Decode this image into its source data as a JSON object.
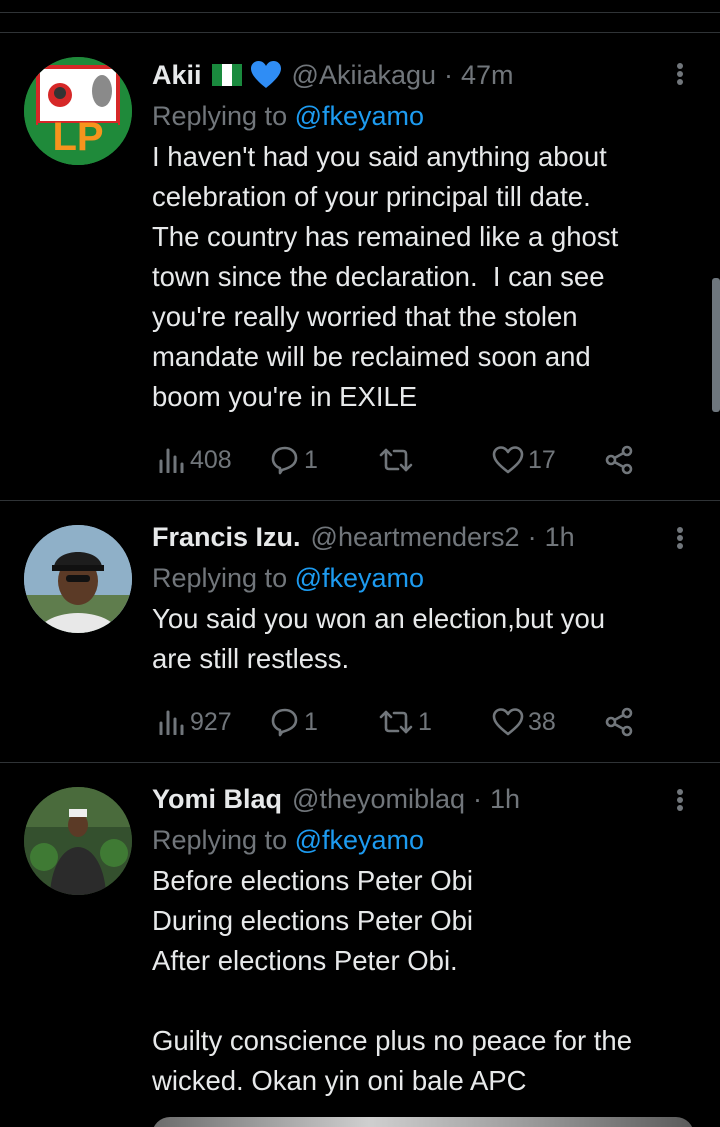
{
  "tweets": [
    {
      "name": "Akii",
      "handle": "@Akiiakagu",
      "separator": "·",
      "time": "47m",
      "replying_prefix": "Replying to",
      "replying_to": "@fkeyamo",
      "avatar_text": "LP",
      "text": "I haven't had you said anything about\ncelebration of your principal till date.\nThe country has remained like a ghost\ntown since the declaration.  I can see\nyou're really worried that the stolen\nmandate will be reclaimed soon and\nboom you're in EXILE",
      "views": "408",
      "replies": "1",
      "retweets": "",
      "likes": "17"
    },
    {
      "name": "Francis Izu.",
      "handle": "@heartmenders2",
      "separator": "·",
      "time": "1h",
      "replying_prefix": "Replying to",
      "replying_to": "@fkeyamo",
      "text": "You said you won an election,but you\nare still restless.",
      "views": "927",
      "replies": "1",
      "retweets": "1",
      "likes": "38"
    },
    {
      "name": "Yomi Blaq",
      "handle": "@theyomiblaq",
      "separator": "·",
      "time": "1h",
      "replying_prefix": "Replying to",
      "replying_to": "@fkeyamo",
      "text": "Before elections Peter Obi\nDuring elections Peter Obi\nAfter elections Peter Obi.\n\nGuilty conscience plus no peace for the\nwicked. Okan yin oni bale APC"
    }
  ],
  "colors": {
    "background": "#000000",
    "text": "#e7e9ea",
    "muted": "#71767b",
    "link": "#1d9bf0",
    "divider": "#2f3336"
  }
}
